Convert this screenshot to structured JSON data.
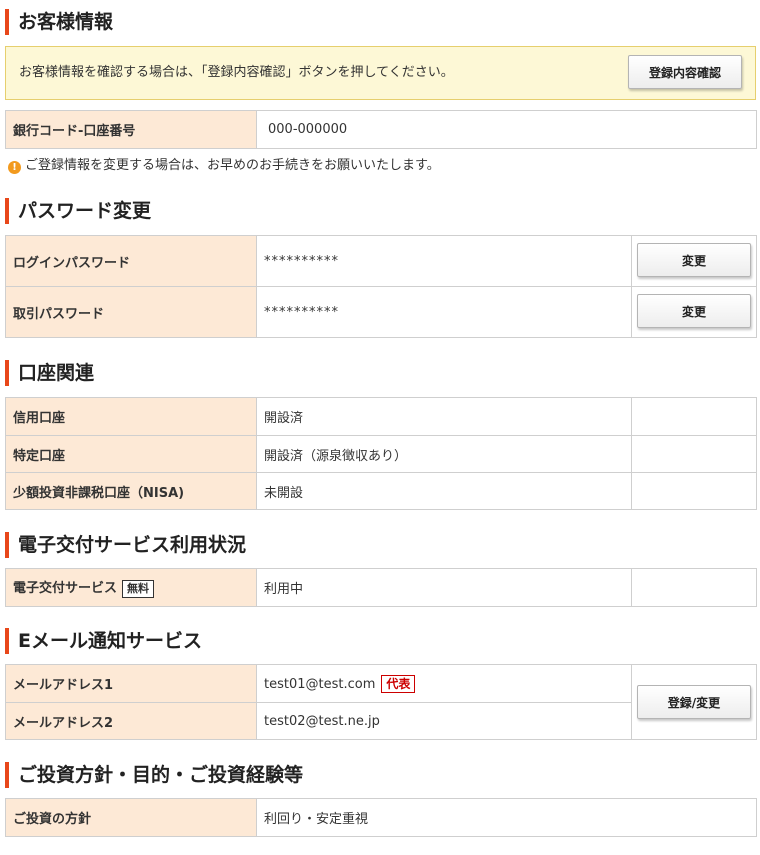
{
  "customer": {
    "title": "お客様情報",
    "notice_text": "お客様情報を確認する場合は、「登録内容確認」ボタンを押してください。",
    "confirm_button": "登録内容確認",
    "bank_label": "銀行コード-口座番号",
    "bank_value": "000-000000",
    "warning": "ご登録情報を変更する場合は、お早めのお手続きをお願いいたします。"
  },
  "password": {
    "title": "パスワード変更",
    "rows": [
      {
        "label": "ログインパスワード",
        "value": "**********",
        "button": "変更"
      },
      {
        "label": "取引パスワード",
        "value": "**********",
        "button": "変更"
      }
    ]
  },
  "account": {
    "title": "口座関連",
    "rows": [
      {
        "label": "信用口座",
        "value": "開設済"
      },
      {
        "label": "特定口座",
        "value": "開設済（源泉徴収あり）"
      },
      {
        "label": "少額投資非課税口座（NISA)",
        "value": "未開設"
      }
    ]
  },
  "edelivery": {
    "title": "電子交付サービス利用状況",
    "label": "電子交付サービス",
    "tag": "無料",
    "value": "利用中"
  },
  "email": {
    "title": "Eメール通知サービス",
    "rows": [
      {
        "label": "メールアドレス1",
        "value": "test01@test.com",
        "tag": "代表"
      },
      {
        "label": "メールアドレス2",
        "value": "test02@test.ne.jp"
      }
    ],
    "button": "登録/変更"
  },
  "investment": {
    "title": "ご投資方針・目的・ご投資経験等",
    "label": "ご投資の方針",
    "value": "利回り・安定重視"
  },
  "colors": {
    "accent": "#e8471a",
    "header_cell": "#fde9d6",
    "notice_bg": "#fdf8d6",
    "tag_red": "#cc0000"
  }
}
